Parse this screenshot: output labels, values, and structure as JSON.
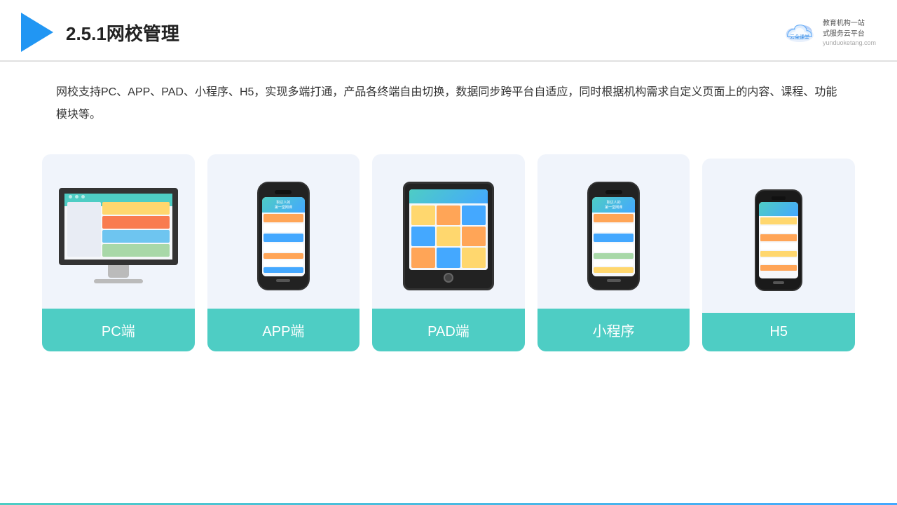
{
  "header": {
    "title": "2.5.1网校管理",
    "brand_name": "云朵课堂",
    "brand_tagline": "教育机构一站\n式服务云平台",
    "brand_url": "yunduoketang.com"
  },
  "description": {
    "text": "网校支持PC、APP、PAD、小程序、H5，实现多端打通，产品各终端自由切换，数据同步跨平台自适应，同时根据机构需求自定义页面上的内容、课程、功能模块等。"
  },
  "cards": [
    {
      "id": "pc",
      "label": "PC端"
    },
    {
      "id": "app",
      "label": "APP端"
    },
    {
      "id": "pad",
      "label": "PAD端"
    },
    {
      "id": "miniapp",
      "label": "小程序"
    },
    {
      "id": "h5",
      "label": "H5"
    }
  ],
  "colors": {
    "teal": "#4ecdc4",
    "blue": "#2196f3",
    "accent": "#44a8ff"
  }
}
